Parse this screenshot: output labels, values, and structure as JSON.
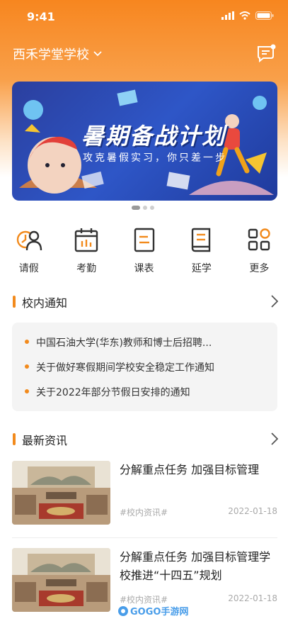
{
  "status_bar": {
    "time": "9:41"
  },
  "header": {
    "school_name": "西禾学堂学校"
  },
  "banner": {
    "title": "暑期备战计划",
    "subtitle": "攻克暑假实习，你只差一步"
  },
  "quick_actions": [
    {
      "label": "请假",
      "icon": "leave-icon"
    },
    {
      "label": "考勤",
      "icon": "attendance-icon"
    },
    {
      "label": "课表",
      "icon": "schedule-icon"
    },
    {
      "label": "延学",
      "icon": "extended-study-icon"
    },
    {
      "label": "更多",
      "icon": "more-grid-icon"
    }
  ],
  "notices": {
    "title": "校内通知",
    "items": [
      "中国石油大学(华东)教师和博士后招聘...",
      "关于做好寒假期间学校安全稳定工作通知",
      "关于2022年部分节假日安排的通知"
    ]
  },
  "news": {
    "title": "最新资讯",
    "items": [
      {
        "headline": "分解重点任务  加强目标管理",
        "tag": "#校内资讯#",
        "date": "2022-01-18"
      },
      {
        "headline": "分解重点任务  加强目标管理学校推进“十四五”规划",
        "tag": "#校内资讯#",
        "date": "2022-01-18"
      }
    ]
  },
  "watermark": {
    "text": "GOGO手游网"
  },
  "colors": {
    "accent": "#f28a1c",
    "header_gradient_top": "#f7861f",
    "banner_blue": "#2e56c7"
  }
}
